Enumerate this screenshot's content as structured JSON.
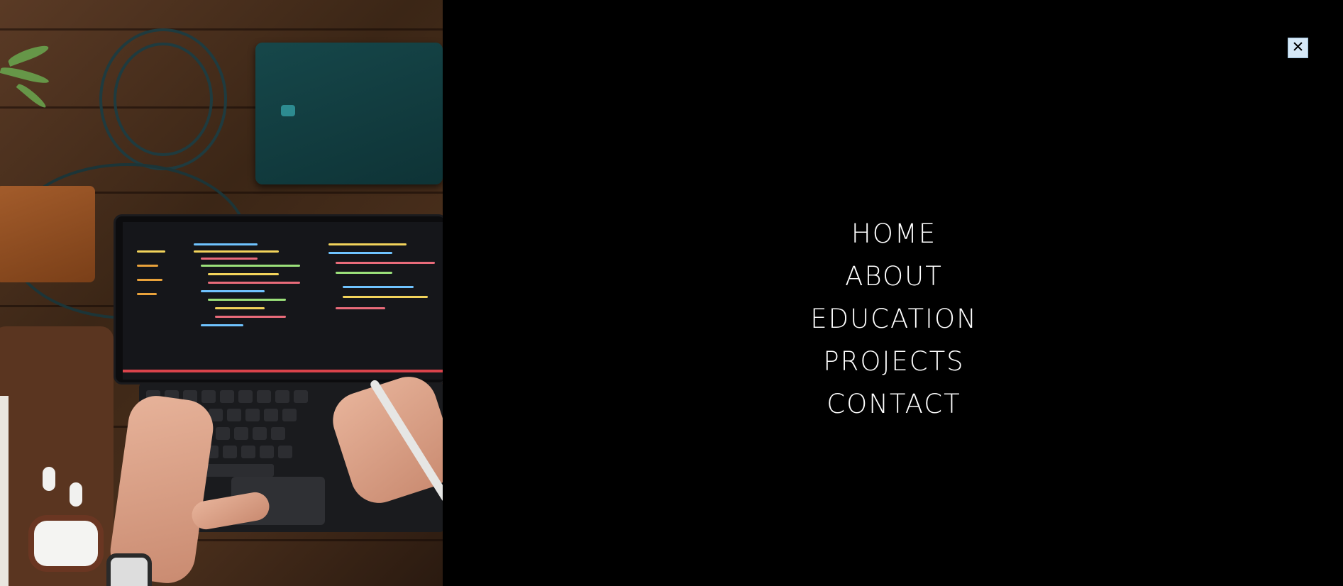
{
  "hero_image": {
    "description_icon": "desk-workspace-photo"
  },
  "menu": {
    "close_icon": "close-icon",
    "items": [
      {
        "label": "HOME"
      },
      {
        "label": "ABOUT"
      },
      {
        "label": "EDUCATION"
      },
      {
        "label": "PROJECTS"
      },
      {
        "label": "CONTACT"
      }
    ]
  },
  "colors": {
    "background": "#000000",
    "menu_text": "#ffffff",
    "close_button_bg": "#d6e9f8"
  }
}
